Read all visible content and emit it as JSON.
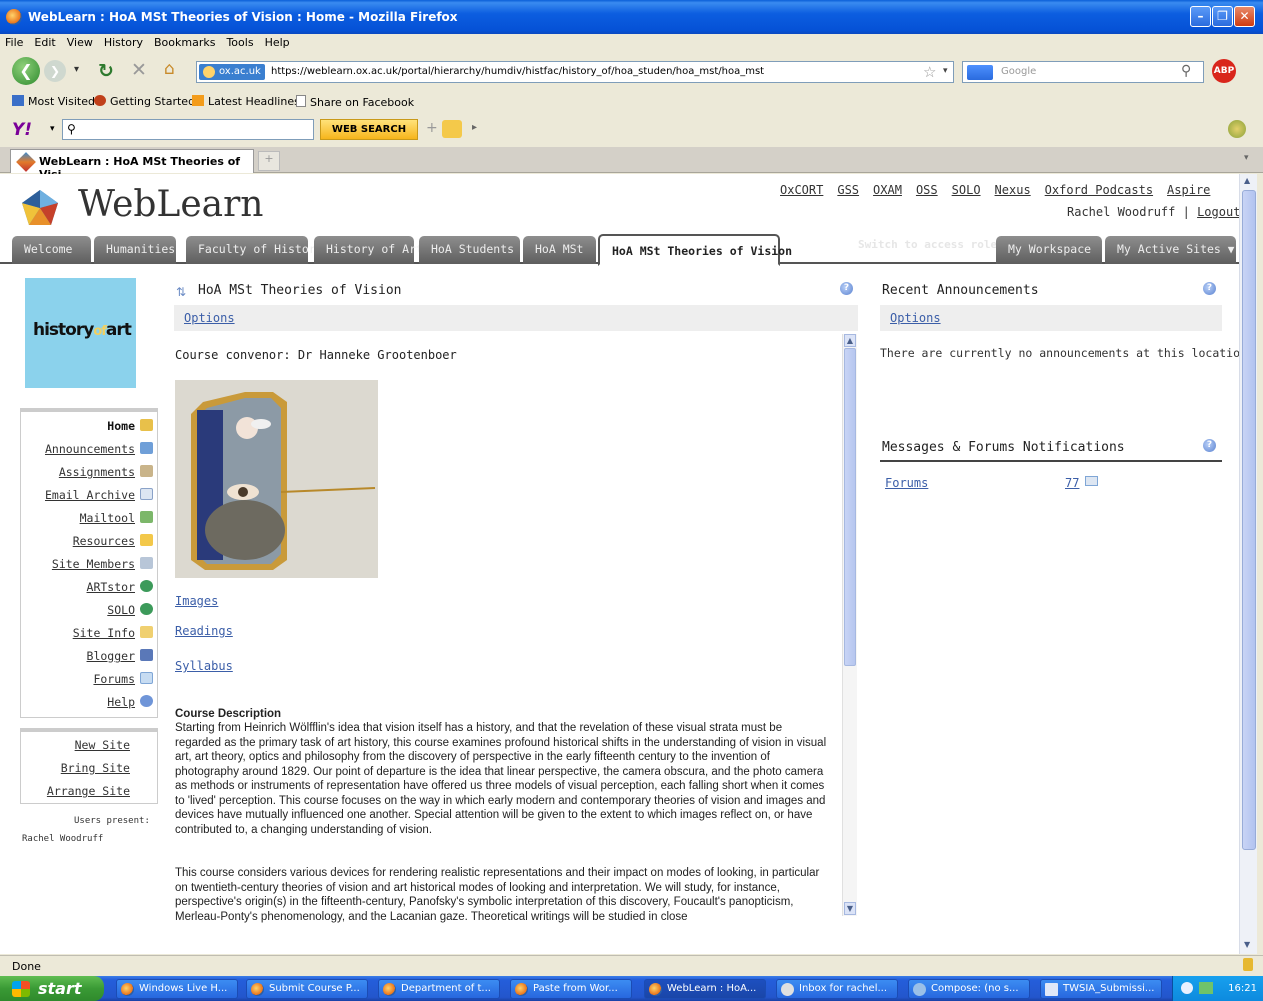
{
  "window": {
    "title": "WebLearn : HoA MSt Theories of Vision : Home - Mozilla Firefox"
  },
  "menu": [
    "File",
    "Edit",
    "View",
    "History",
    "Bookmarks",
    "Tools",
    "Help"
  ],
  "navbar": {
    "site_badge": "ox.ac.uk",
    "url": "https://weblearn.ox.ac.uk/portal/hierarchy/humdiv/histfac/history_of/hoa_studen/hoa_mst/hoa_mst",
    "search_placeholder": "Google"
  },
  "bookmarks": [
    "Most Visited",
    "Getting Started",
    "Latest Headlines",
    "Share on Facebook"
  ],
  "yahoo": {
    "button": "WEB SEARCH"
  },
  "browser_tab": {
    "label": "WebLearn : HoA MSt Theories of Visi..."
  },
  "header": {
    "logo_text": "WebLearn",
    "links": [
      "OxCORT",
      "GSS",
      "OXAM",
      "OSS",
      "SOLO",
      "Nexus",
      "Oxford Podcasts",
      "Aspire"
    ],
    "user_name": "Rachel Woodruff",
    "separator": "|",
    "logout": "Logout"
  },
  "site_tabs": [
    "Welcome",
    "Humanities",
    "Faculty of History",
    "History of Art",
    "HoA Students",
    "HoA MSt",
    "HoA MSt Theories of Vision"
  ],
  "switch_role": "Switch to access role",
  "workspace_tabs": [
    "My Workspace",
    "My Active Sites"
  ],
  "site_logo": {
    "part1": "history",
    "part2": "of",
    "part3": "art"
  },
  "tool_menu": [
    "Home",
    "Announcements",
    "Assignments",
    "Email Archive",
    "Mailtool",
    "Resources",
    "Site Members",
    "ARTstor",
    "SOLO",
    "Site Info",
    "Blogger",
    "Forums",
    "Help"
  ],
  "site_actions": [
    "New Site",
    "Bring Site",
    "Arrange Site"
  ],
  "presence": {
    "label": "Users present:",
    "users": [
      "Rachel Woodruff"
    ]
  },
  "main": {
    "title": "HoA MSt Theories of Vision",
    "options": "Options",
    "convenor": "Course convenor: Dr Hanneke Grootenboer",
    "links": [
      "Images",
      "Readings",
      "Syllabus"
    ],
    "desc_heading": "Course Description",
    "desc_p1": "Starting from Heinrich Wölfflin's idea that vision itself has a history, and that the revelation of these visual strata must be regarded as the primary task of art history, this course examines profound historical shifts in the understanding of vision in visual art, art theory, optics and philosophy from the discovery of perspective in the early fifteenth century to the invention of photography around 1829.  Our point of departure is the idea that linear perspective, the camera obscura, and the photo camera as methods or instruments of representation have offered us three models of visual perception, each falling short when it comes to 'lived' perception.  This course focuses on the way in which early modern and contemporary theories of vision and images and devices have mutually influenced one another.  Special attention will be given to the extent to which images reflect on, or have contributed to, a changing understanding of vision.",
    "desc_p2": "This course considers various devices for rendering realistic representations and their impact on modes of looking, in particular on twentieth-century theories of vision and art historical modes of looking and interpretation.  We will study, for instance, perspective's origin(s) in the fifteenth-century, Panofsky's symbolic interpretation of this discovery, Foucault's panopticism, Merleau-Ponty's phenomenology, and the Lacanian gaze.  Theoretical writings will be studied in close"
  },
  "announcements": {
    "title": "Recent Announcements",
    "options": "Options",
    "empty": "There are currently no announcements at this location."
  },
  "messages": {
    "title": "Messages & Forums Notifications",
    "forums_label": "Forums",
    "forums_count": "77"
  },
  "status": "Done",
  "taskbar": {
    "start": "start",
    "items": [
      "Windows Live H...",
      "Submit Course P...",
      "Department of t...",
      "Paste from Wor...",
      "WebLearn : HoA...",
      "Inbox for rachel...",
      "Compose: (no s...",
      "TWSIA_Submissi..."
    ],
    "clock": "16:21"
  }
}
